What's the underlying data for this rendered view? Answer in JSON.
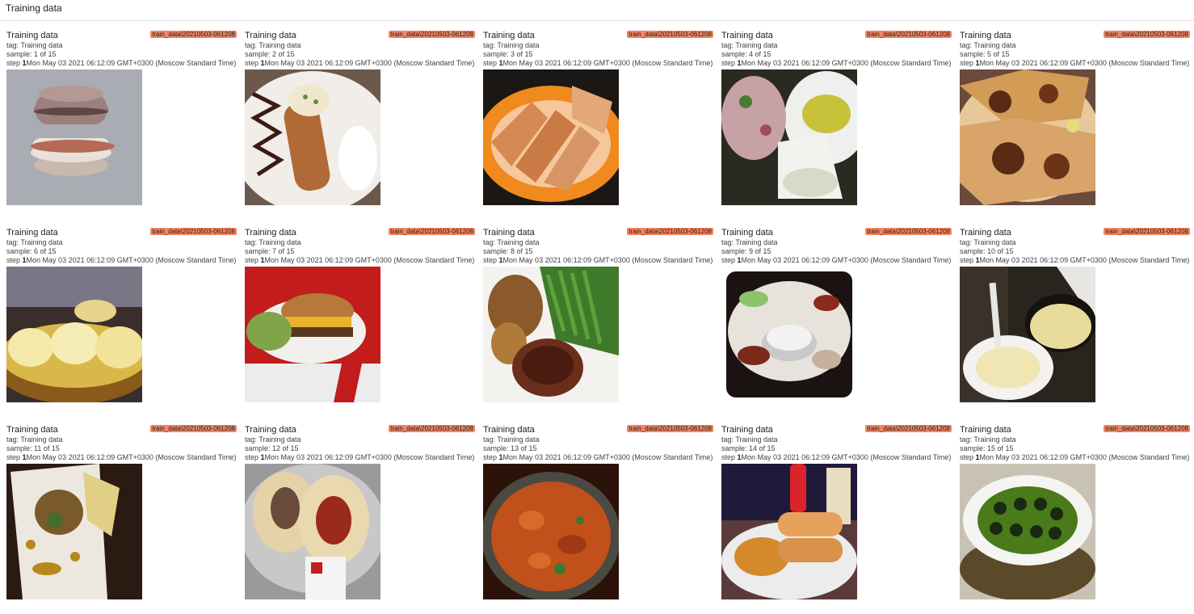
{
  "header": {
    "title": "Training data"
  },
  "cards": [
    {
      "title": "Training data",
      "run": "train_data\\20210503-061208",
      "tag": "tag: Training data",
      "sample": "sample: 1 of 15",
      "step_label": "step",
      "step_value": "1",
      "timestamp": "Mon May 03 2021 06:12:09 GMT+0300 (Moscow Standard Time)",
      "image": "macaron-icon"
    },
    {
      "title": "Training data",
      "run": "train_data\\20210503-061208",
      "tag": "tag: Training data",
      "sample": "sample: 2 of 15",
      "step_label": "step",
      "step_value": "1",
      "timestamp": "Mon May 03 2021 06:12:09 GMT+0300 (Moscow Standard Time)",
      "image": "cannoli-icon"
    },
    {
      "title": "Training data",
      "run": "train_data\\20210503-061208",
      "tag": "tag: Training data",
      "sample": "sample: 3 of 15",
      "step_label": "step",
      "step_value": "1",
      "timestamp": "Mon May 03 2021 06:12:09 GMT+0300 (Moscow Standard Time)",
      "image": "salmon-icon"
    },
    {
      "title": "Training data",
      "run": "train_data\\20210503-061208",
      "tag": "tag: Training data",
      "sample": "sample: 4 of 15",
      "step_label": "step",
      "step_value": "1",
      "timestamp": "Mon May 03 2021 06:12:09 GMT+0300 (Moscow Standard Time)",
      "image": "salad-plate-icon"
    },
    {
      "title": "Training data",
      "run": "train_data\\20210503-061208",
      "tag": "tag: Training data",
      "sample": "sample: 5 of 15",
      "step_label": "step",
      "step_value": "1",
      "timestamp": "Mon May 03 2021 06:12:09 GMT+0300 (Moscow Standard Time)",
      "image": "quesadilla-icon"
    },
    {
      "title": "Training data",
      "run": "train_data\\20210503-061208",
      "tag": "tag: Training data",
      "sample": "sample: 6 of 15",
      "step_label": "step",
      "step_value": "1",
      "timestamp": "Mon May 03 2021 06:12:09 GMT+0300 (Moscow Standard Time)",
      "image": "dumplings-icon"
    },
    {
      "title": "Training data",
      "run": "train_data\\20210503-061208",
      "tag": "tag: Training data",
      "sample": "sample: 7 of 15",
      "step_label": "step",
      "step_value": "1",
      "timestamp": "Mon May 03 2021 06:12:09 GMT+0300 (Moscow Standard Time)",
      "image": "burger-icon"
    },
    {
      "title": "Training data",
      "run": "train_data\\20210503-061208",
      "tag": "tag: Training data",
      "sample": "sample: 8 of 15",
      "step_label": "step",
      "step_value": "1",
      "timestamp": "Mon May 03 2021 06:12:09 GMT+0300 (Moscow Standard Time)",
      "image": "steak-icon"
    },
    {
      "title": "Training data",
      "run": "train_data\\20210503-061208",
      "tag": "tag: Training data",
      "sample": "sample: 9 of 15",
      "step_label": "step",
      "step_value": "1",
      "timestamp": "Mon May 03 2021 06:12:09 GMT+0300 (Moscow Standard Time)",
      "image": "platter-icon"
    },
    {
      "title": "Training data",
      "run": "train_data\\20210503-061208",
      "tag": "tag: Training data",
      "sample": "sample: 10 of 15",
      "step_label": "step",
      "step_value": "1",
      "timestamp": "Mon May 03 2021 06:12:09 GMT+0300 (Moscow Standard Time)",
      "image": "cooking-pan-icon"
    },
    {
      "title": "Training data",
      "run": "train_data\\20210503-061208",
      "tag": "tag: Training data",
      "sample": "sample: 11 of 15",
      "step_label": "step",
      "step_value": "1",
      "timestamp": "Mon May 03 2021 06:12:09 GMT+0300 (Moscow Standard Time)",
      "image": "plated-dish-icon"
    },
    {
      "title": "Training data",
      "run": "train_data\\20210503-061208",
      "tag": "tag: Training data",
      "sample": "sample: 12 of 15",
      "step_label": "step",
      "step_value": "1",
      "timestamp": "Mon May 03 2021 06:12:09 GMT+0300 (Moscow Standard Time)",
      "image": "burrito-icon"
    },
    {
      "title": "Training data",
      "run": "train_data\\20210503-061208",
      "tag": "tag: Training data",
      "sample": "sample: 13 of 15",
      "step_label": "step",
      "step_value": "1",
      "timestamp": "Mon May 03 2021 06:12:09 GMT+0300 (Moscow Standard Time)",
      "image": "curry-icon"
    },
    {
      "title": "Training data",
      "run": "train_data\\20210503-061208",
      "tag": "tag: Training data",
      "sample": "sample: 14 of 15",
      "step_label": "step",
      "step_value": "1",
      "timestamp": "Mon May 03 2021 06:12:09 GMT+0300 (Moscow Standard Time)",
      "image": "sandwich-icon"
    },
    {
      "title": "Training data",
      "run": "train_data\\20210503-061208",
      "tag": "tag: Training data",
      "sample": "sample: 15 of 15",
      "step_label": "step",
      "step_value": "1",
      "timestamp": "Mon May 03 2021 06:12:09 GMT+0300 (Moscow Standard Time)",
      "image": "escargot-icon"
    }
  ],
  "colors": {
    "run_badge": "#f4845f",
    "divider": "#dcdcdc"
  }
}
